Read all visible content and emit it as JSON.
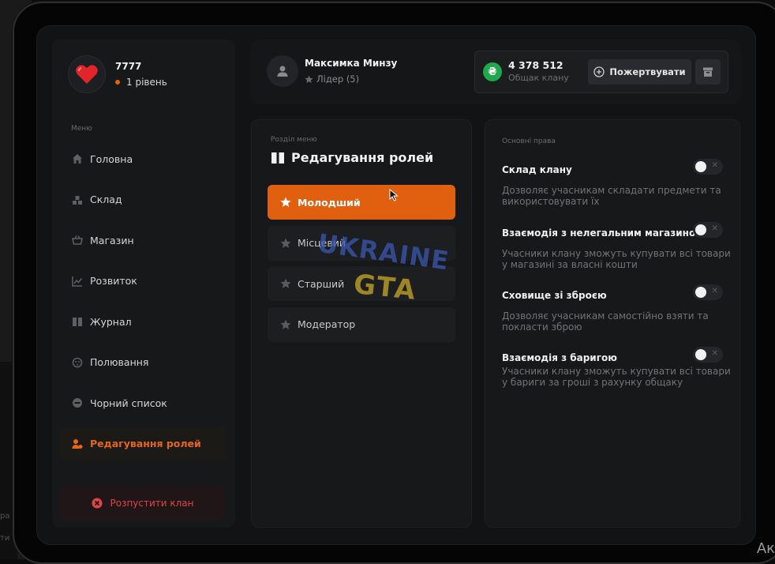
{
  "background": {
    "left_text_1": "рa",
    "left_text_2": "ти",
    "corner_text": "Ак"
  },
  "profile": {
    "name": "7777",
    "level": "1 рівень"
  },
  "sidebar": {
    "menu_label": "Меню",
    "items": [
      {
        "label": "Головна",
        "icon": "home-icon"
      },
      {
        "label": "Склад",
        "icon": "warehouse-icon"
      },
      {
        "label": "Магазин",
        "icon": "basket-icon"
      },
      {
        "label": "Розвиток",
        "icon": "chart-icon"
      },
      {
        "label": "Журнал",
        "icon": "book-icon"
      },
      {
        "label": "Полювання",
        "icon": "target-icon"
      },
      {
        "label": "Чорний список",
        "icon": "block-icon"
      },
      {
        "label": "Редагування ролей",
        "icon": "users-icon",
        "active": true
      }
    ],
    "disband_label": "Розпустити клан"
  },
  "header": {
    "leader_name": "Максимка Минзу",
    "leader_role": "Лідер (5)",
    "fund_amount": "4 378 512",
    "fund_label": "Общак клану",
    "coin_symbol": "₴",
    "donate_label": "Пожертвувати"
  },
  "roles": {
    "section_label": "Розділ меню",
    "title": "Редагування ролей",
    "items": [
      {
        "label": "Молодший",
        "active": true
      },
      {
        "label": "Місцевий"
      },
      {
        "label": "Старший"
      },
      {
        "label": "Модератор"
      }
    ]
  },
  "watermark": {
    "top": "UKRAINE",
    "bottom": "GTA"
  },
  "rights": {
    "section_label": "Основні права",
    "items": [
      {
        "title": "Склад клану",
        "desc": "Дозволяє учасникам складати предмети та використовувати їх",
        "enabled": false
      },
      {
        "title": "Взаємодія з нелегальним магазином",
        "desc": "Учасники клану зможуть купувати всі товари у магазині за власні кошти",
        "enabled": false
      },
      {
        "title": "Сховище зі зброєю",
        "desc": "Дозволяє учасникам самостійно взяти та покласти зброю",
        "enabled": false
      },
      {
        "title": "Взаємодія з баригою",
        "desc": "Учасники клану зможуть купувати всі товари у бариги за гроші з рахунку общаку",
        "enabled": false
      }
    ],
    "toggle_off_symbol": "✕"
  },
  "colors": {
    "accent": "#e06010",
    "danger": "#e04545",
    "money": "#1fa84c",
    "panel": "#17181a"
  }
}
